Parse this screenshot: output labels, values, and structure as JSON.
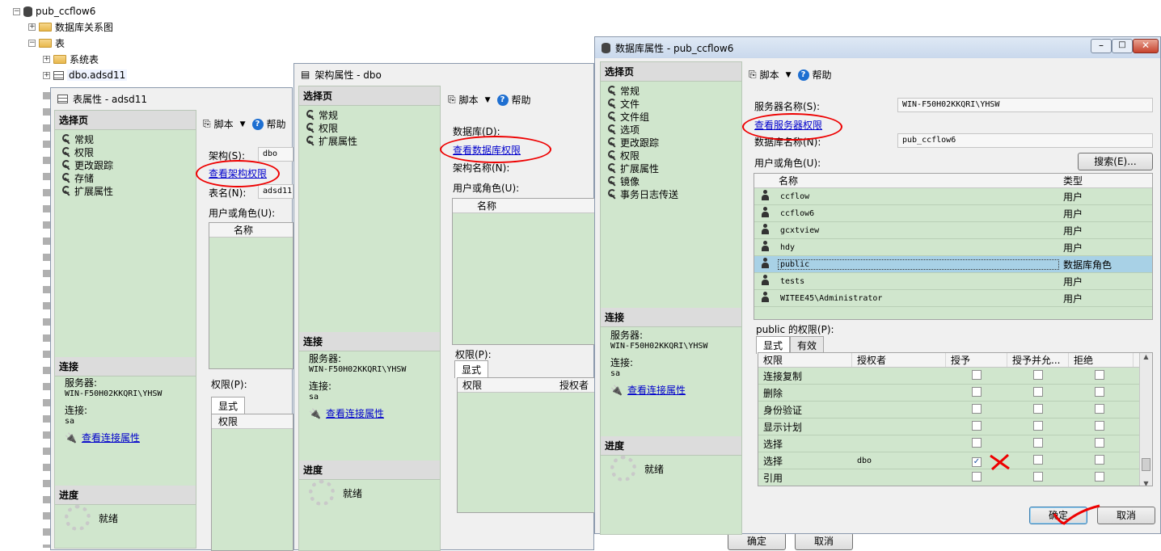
{
  "tree": {
    "db": "pub_ccflow6",
    "diagrams": "数据库关系图",
    "tables": "表",
    "system_tables": "系统表",
    "table1": "dbo.adsd11"
  },
  "w1": {
    "title": "表属性 - adsd11",
    "select_page": "选择页",
    "items": [
      "常规",
      "权限",
      "更改跟踪",
      "存储",
      "扩展属性"
    ],
    "toolbar_script": "脚本",
    "toolbar_help": "帮助",
    "schema_label": "架构(S):",
    "schema_value": "dbo",
    "schema_link": "查看架构权限",
    "table_label": "表名(N):",
    "table_value": "adsd11",
    "users_label": "用户或角色(U):",
    "col_name": "名称",
    "perm_label": "权限(P):",
    "tab_explicit": "显式",
    "perm_col": "权限",
    "connection": "连接",
    "server_label": "服务器:",
    "server_value": "WIN-F50H02KKQRI\\YHSW",
    "conn_label": "连接:",
    "conn_value": "sa",
    "conn_link": "查看连接属性",
    "progress": "进度",
    "ready": "就绪"
  },
  "w2": {
    "title": "架构属性 - dbo",
    "select_page": "选择页",
    "items": [
      "常规",
      "权限",
      "扩展属性"
    ],
    "toolbar_script": "脚本",
    "toolbar_help": "帮助",
    "db_label": "数据库(D):",
    "db_link": "查看数据库权限",
    "schema_name_label": "架构名称(N):",
    "users_label": "用户或角色(U):",
    "col_name": "名称",
    "perm_label": "权限(P):",
    "tab_explicit": "显式",
    "perm_col": "权限",
    "grantor_col": "授权者",
    "connection": "连接",
    "server_label": "服务器:",
    "server_value": "WIN-F50H02KKQRI\\YHSW",
    "conn_label": "连接:",
    "conn_value": "sa",
    "conn_link": "查看连接属性",
    "progress": "进度",
    "ready": "就绪",
    "ok": "确定",
    "cancel": "取消"
  },
  "w3": {
    "title": "数据库属性 - pub_ccflow6",
    "select_page": "选择页",
    "items": [
      "常规",
      "文件",
      "文件组",
      "选项",
      "更改跟踪",
      "权限",
      "扩展属性",
      "镜像",
      "事务日志传送"
    ],
    "toolbar_script": "脚本",
    "toolbar_help": "帮助",
    "server_label": "服务器名称(S):",
    "server_value": "WIN-F50H02KKQRI\\YHSW",
    "server_link": "查看服务器权限",
    "db_label": "数据库名称(N):",
    "db_value": "pub_ccflow6",
    "users_label": "用户或角色(U):",
    "search_btn": "搜索(E)...",
    "col_name": "名称",
    "col_type": "类型",
    "users": [
      {
        "name": "ccflow",
        "type": "用户"
      },
      {
        "name": "ccflow6",
        "type": "用户"
      },
      {
        "name": "gcxtview",
        "type": "用户"
      },
      {
        "name": "hdy",
        "type": "用户"
      },
      {
        "name": "public",
        "type": "数据库角色"
      },
      {
        "name": "tests",
        "type": "用户"
      },
      {
        "name": "WITEE45\\Administrator",
        "type": "用户"
      }
    ],
    "perm_title": "public 的权限(P):",
    "tab_explicit": "显式",
    "tab_effective": "有效",
    "perm_cols": [
      "权限",
      "授权者",
      "授予",
      "授予并允...",
      "拒绝"
    ],
    "perms": [
      {
        "perm": "连接复制",
        "grantor": "",
        "grant": false
      },
      {
        "perm": "删除",
        "grantor": "",
        "grant": false
      },
      {
        "perm": "身份验证",
        "grantor": "",
        "grant": false
      },
      {
        "perm": "显示计划",
        "grantor": "",
        "grant": false
      },
      {
        "perm": "选择",
        "grantor": "",
        "grant": false
      },
      {
        "perm": "选择",
        "grantor": "dbo",
        "grant": true
      },
      {
        "perm": "引用",
        "grantor": "",
        "grant": false
      }
    ],
    "connection": "连接",
    "server_conn_label": "服务器:",
    "conn_label": "连接:",
    "conn_value": "sa",
    "conn_link": "查看连接属性",
    "progress": "进度",
    "ready": "就绪",
    "ok": "确定",
    "cancel": "取消"
  },
  "colors": {
    "green_panel": "#d0e6cd",
    "selected_row": "#a8d1e6",
    "annotation_red": "#e00000"
  }
}
